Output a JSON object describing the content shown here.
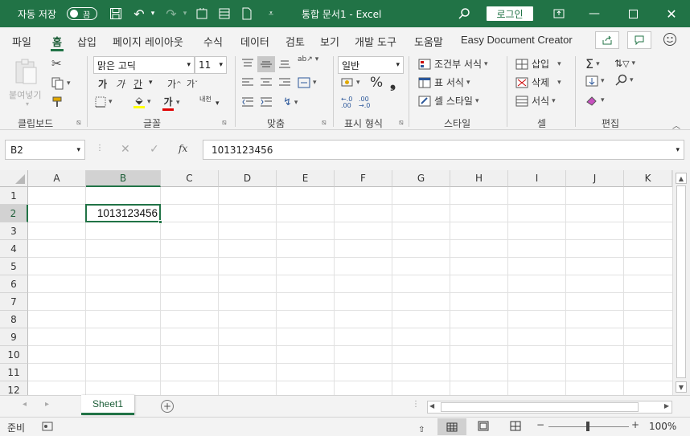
{
  "titlebar": {
    "autosave_label": "자동 저장",
    "autosave_state": "끔",
    "doc_title": "통합 문서1 - Excel",
    "login_label": "로그인"
  },
  "menu": [
    "파일",
    "홈",
    "삽입",
    "페이지 레이아웃",
    "수식",
    "데이터",
    "검토",
    "보기",
    "개발 도구",
    "도움말",
    "Easy Document Creator"
  ],
  "ribbon": {
    "clipboard": {
      "paste_label": "붙여넣기",
      "group_label": "클립보드"
    },
    "font": {
      "font_name": "맑은 고딕",
      "font_size": "11",
      "bold": "가",
      "italic": "가",
      "underline": "간",
      "grow": "가",
      "shrink": "가",
      "font_color_glyph": "가",
      "phonetic": "내천",
      "group_label": "글꼴"
    },
    "alignment": {
      "group_label": "맞춤"
    },
    "number": {
      "format": "일반",
      "group_label": "표시 형식"
    },
    "styles": {
      "conditional": "조건부 서식",
      "table": "표 서식",
      "cell_styles": "셀 스타일",
      "group_label": "스타일"
    },
    "cells": {
      "insert": "삽입",
      "delete": "삭제",
      "format": "서식",
      "group_label": "셀"
    },
    "editing": {
      "group_label": "편집"
    }
  },
  "formula_bar": {
    "name_box": "B2",
    "fx": "fx",
    "value": "1013123456"
  },
  "grid": {
    "columns": [
      "A",
      "B",
      "C",
      "D",
      "E",
      "F",
      "G",
      "H",
      "I",
      "J",
      "K"
    ],
    "rows": [
      "1",
      "2",
      "3",
      "4",
      "5",
      "6",
      "7",
      "8",
      "9",
      "10",
      "11",
      "12"
    ],
    "selected_cell": {
      "col": "B",
      "row": "2",
      "value": "1013123456"
    }
  },
  "sheet_tabs": {
    "active": "Sheet1"
  },
  "status": {
    "mode": "준비",
    "zoom": "100%"
  },
  "colors": {
    "brand": "#217346",
    "ribbon_bg": "#f3f3f3",
    "selection": "#217346"
  }
}
